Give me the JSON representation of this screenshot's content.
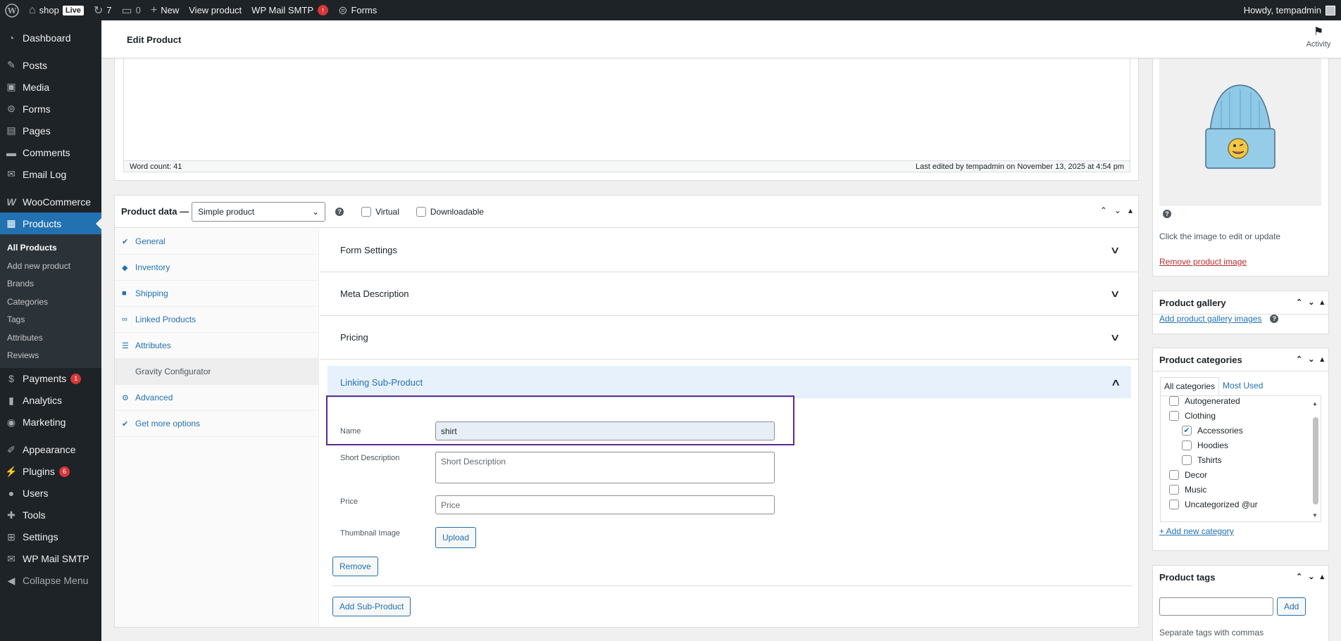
{
  "adminbar": {
    "site_name": "shop",
    "live_badge": "Live",
    "updates_count": "7",
    "comments_count": "0",
    "new_label": "New",
    "view_product": "View product",
    "wp_mail_smtp": "WP Mail SMTP",
    "wp_mail_smtp_badge": "!",
    "forms": "Forms",
    "howdy": "Howdy, tempadmin"
  },
  "sidebar": {
    "dashboard": "Dashboard",
    "posts": "Posts",
    "media": "Media",
    "forms": "Forms",
    "pages": "Pages",
    "comments": "Comments",
    "email_log": "Email Log",
    "woocommerce": "WooCommerce",
    "products": "Products",
    "submenu": [
      "All Products",
      "Add new product",
      "Brands",
      "Categories",
      "Tags",
      "Attributes",
      "Reviews"
    ],
    "payments": "Payments",
    "payments_count": "1",
    "analytics": "Analytics",
    "marketing": "Marketing",
    "appearance": "Appearance",
    "plugins": "Plugins",
    "plugins_count": "6",
    "users": "Users",
    "tools": "Tools",
    "settings": "Settings",
    "wp_mail_smtp": "WP Mail SMTP",
    "collapse": "Collapse Menu"
  },
  "header": {
    "title": "Edit Product",
    "activity": "Activity"
  },
  "editor": {
    "word_count": "Word count: 41",
    "last_edited": "Last edited by tempadmin on November 13, 2025 at 4:54 pm"
  },
  "product_data": {
    "title": "Product data —",
    "type_value": "Simple product",
    "help": "?",
    "virtual": "Virtual",
    "downloadable": "Downloadable",
    "tabs": [
      "General",
      "Inventory",
      "Shipping",
      "Linked Products",
      "Attributes",
      "Gravity Configurator",
      "Advanced",
      "Get more options"
    ],
    "sections": {
      "form_settings": "Form Settings",
      "meta_description": "Meta Description",
      "pricing": "Pricing",
      "linking": "Linking Sub-Product"
    },
    "subproduct": {
      "name_label": "Name",
      "name_value": "shirt",
      "short_desc_label": "Short Description",
      "short_desc_placeholder": "Short Description",
      "price_label": "Price",
      "price_placeholder": "Price",
      "thumbnail_label": "Thumbnail Image",
      "upload": "Upload",
      "remove": "Remove",
      "add_sub": "Add Sub-Product"
    }
  },
  "product_image": {
    "help": "?",
    "click_hint": "Click the image to edit or update",
    "remove": "Remove product image"
  },
  "gallery": {
    "title": "Product gallery",
    "add": "Add product gallery images",
    "help": "?"
  },
  "categories": {
    "title": "Product categories",
    "tab_all": "All categories",
    "tab_used": "Most Used",
    "items": [
      {
        "label": "Autogenerated",
        "checked": false,
        "child": false
      },
      {
        "label": "Clothing",
        "checked": false,
        "child": false
      },
      {
        "label": "Accessories",
        "checked": true,
        "child": true
      },
      {
        "label": "Hoodies",
        "checked": false,
        "child": true
      },
      {
        "label": "Tshirts",
        "checked": false,
        "child": true
      },
      {
        "label": "Decor",
        "checked": false,
        "child": false
      },
      {
        "label": "Music",
        "checked": false,
        "child": false
      },
      {
        "label": "Uncategorized @ur",
        "checked": false,
        "child": false
      }
    ],
    "add_new": "+ Add new category"
  },
  "tags": {
    "title": "Product tags",
    "add_button": "Add",
    "hint": "Separate tags with commas"
  },
  "colors": {
    "accent": "#2271b1",
    "admin_dark": "#1d2327",
    "highlight_border": "#5b2a8c",
    "badge_red": "#d63638"
  }
}
